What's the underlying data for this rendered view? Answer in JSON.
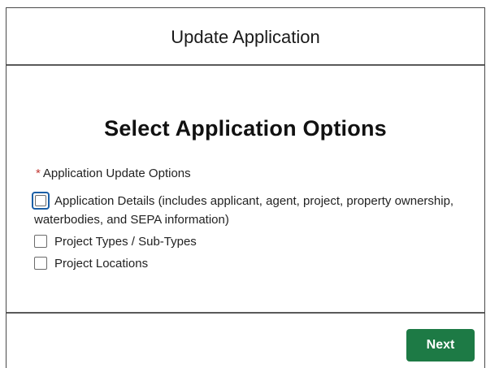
{
  "modal": {
    "title": "Update Application"
  },
  "section": {
    "title": "Select Application Options"
  },
  "field": {
    "required_marker": "*",
    "label": "Application Update Options",
    "options": [
      {
        "label": "Application Details (includes applicant, agent, project, property ownership, waterbodies, and SEPA information)",
        "checked": false,
        "focused": true
      },
      {
        "label": "Project Types / Sub-Types",
        "checked": false,
        "focused": false
      },
      {
        "label": "Project Locations",
        "checked": false,
        "focused": false
      }
    ]
  },
  "footer": {
    "next_label": "Next"
  },
  "colors": {
    "primary_button": "#1d7a45",
    "required_marker": "#c23934",
    "focus_ring": "#1b5fa6"
  }
}
